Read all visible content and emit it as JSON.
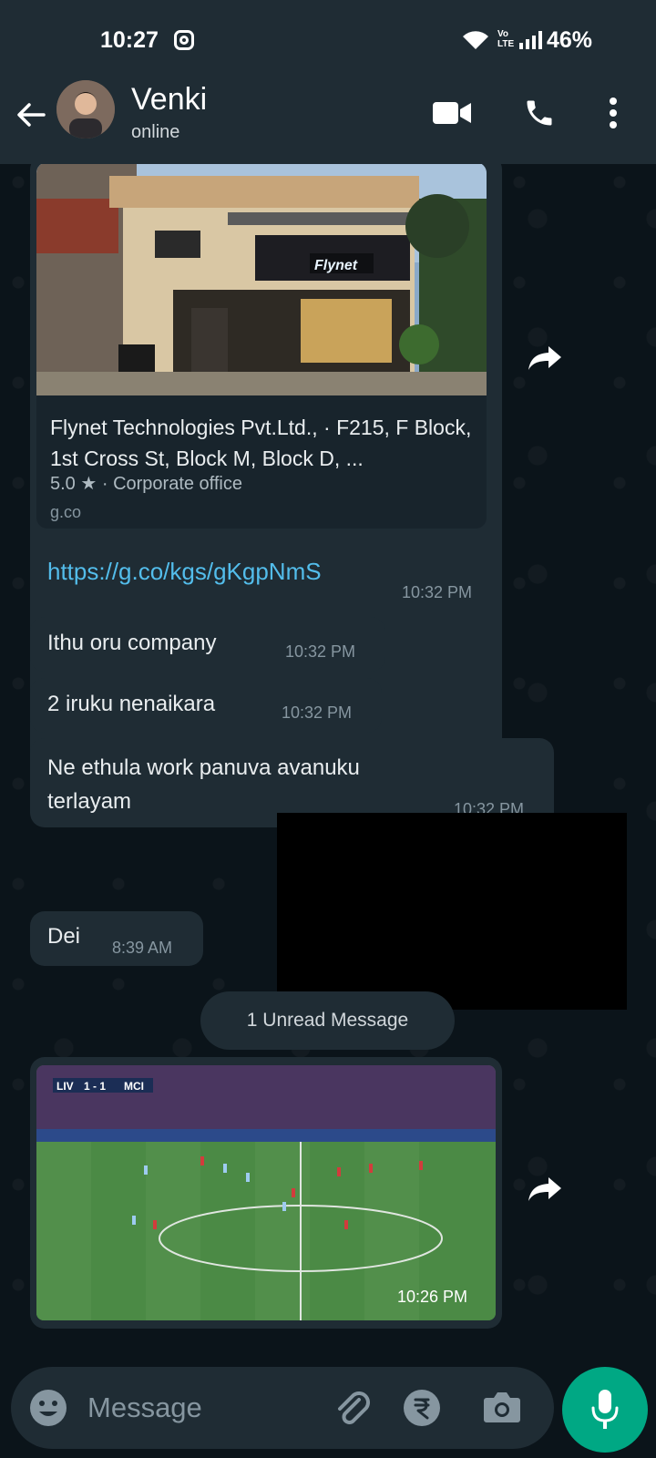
{
  "status_bar": {
    "time": "10:27",
    "network_label": "Vo LTE",
    "battery": "46%"
  },
  "header": {
    "contact_name": "Venki",
    "contact_status": "online",
    "icons": [
      "back-arrow-icon",
      "video-call-icon",
      "voice-call-icon",
      "more-options-icon"
    ]
  },
  "messages": {
    "link_preview": {
      "image_sign": "Flynet",
      "title": "Flynet Technologies Pvt.Ltd., · F215, F Block, 1st Cross St, Block M, Block D, ...",
      "rating": "5.0 ★ · Corporate office",
      "domain": "g.co",
      "url": "https://g.co/kgs/gKgpNmS",
      "time": "10:32 PM"
    },
    "m1": {
      "text": "Ithu oru company",
      "time": "10:32 PM"
    },
    "m2": {
      "text": "2 iruku nenaikara",
      "time": "10:32 PM"
    },
    "m3": {
      "text": "Ne ethula work panuva avanuku terlayam",
      "time": "10:32 PM"
    },
    "m4": {
      "text": "Dei",
      "time": "8:39 AM"
    },
    "unread_label": "1 Unread Message",
    "photo": {
      "time": "10:26 PM",
      "score_home": "LIV",
      "score": "1 - 1",
      "score_away": "MCI"
    }
  },
  "input": {
    "placeholder": "Message"
  },
  "colors": {
    "background": "#0b141a",
    "bubble": "#1f2c34",
    "link": "#53bdeb",
    "accent": "#00a884"
  }
}
